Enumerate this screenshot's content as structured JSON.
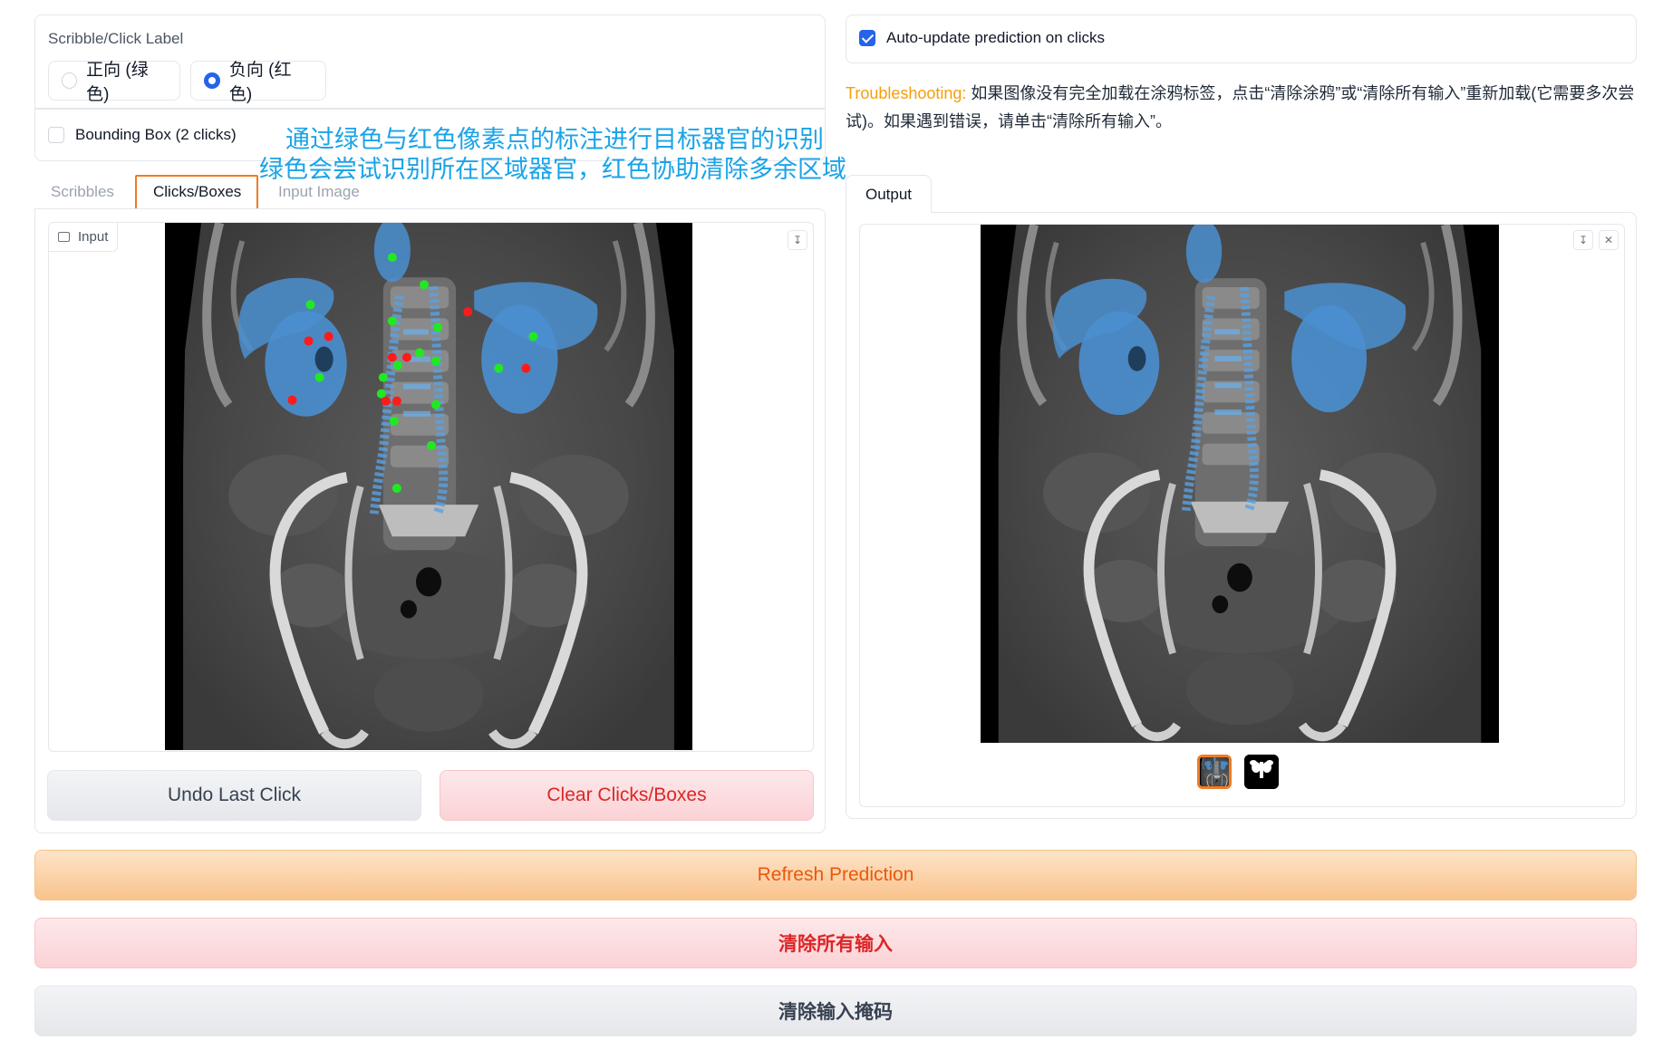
{
  "label_block": {
    "title": "Scribble/Click Label",
    "option_positive": "正向 (绿色)",
    "option_negative": "负向 (红色)",
    "selected": "负向 (红色)",
    "bbox_label": "Bounding Box (2 clicks)",
    "bbox_checked": false
  },
  "annotation": {
    "line1": "通过绿色与红色像素点的标注进行目标器官的识别",
    "line2": "绿色会尝试识别所在区域器官，红色协助清除多余区域",
    "color": "#1aa3e8"
  },
  "tabs": {
    "items": [
      "Scribbles",
      "Clicks/Boxes",
      "Input Image"
    ],
    "active": "Clicks/Boxes",
    "highlight_color": "#f07b22"
  },
  "input_panel": {
    "label": "Input",
    "download_icon": "download-icon"
  },
  "buttons": {
    "undo": "Undo Last Click",
    "clear_clicks": "Clear Clicks/Boxes",
    "refresh": "Refresh Prediction",
    "clear_all": "清除所有输入",
    "clear_mask": "清除输入掩码"
  },
  "auto_update": {
    "label": "Auto-update prediction on clicks",
    "checked": true
  },
  "troubleshooting": {
    "label": "Troubleshooting:",
    "text": " 如果图像没有完全加载在涂鸦标签，点击“清除涂鸦”或“清除所有输入”重新加载(它需要多次尝试)。如果遇到错误，请单击“清除所有输入”。"
  },
  "output_panel": {
    "tab_label": "Output",
    "download_icon": "download-icon",
    "close_icon": "close-icon",
    "thumbnails": [
      "ct-overlay-thumbnail",
      "mask-thumbnail"
    ],
    "selected_thumbnail": "ct-overlay-thumbnail"
  },
  "colors": {
    "accent_blue": "#2563eb",
    "orange": "#ea580c",
    "red": "#dc2626",
    "organ_mask": "#4a8fd0",
    "positive_click": "#22e822",
    "negative_click": "#ff1a1a"
  }
}
